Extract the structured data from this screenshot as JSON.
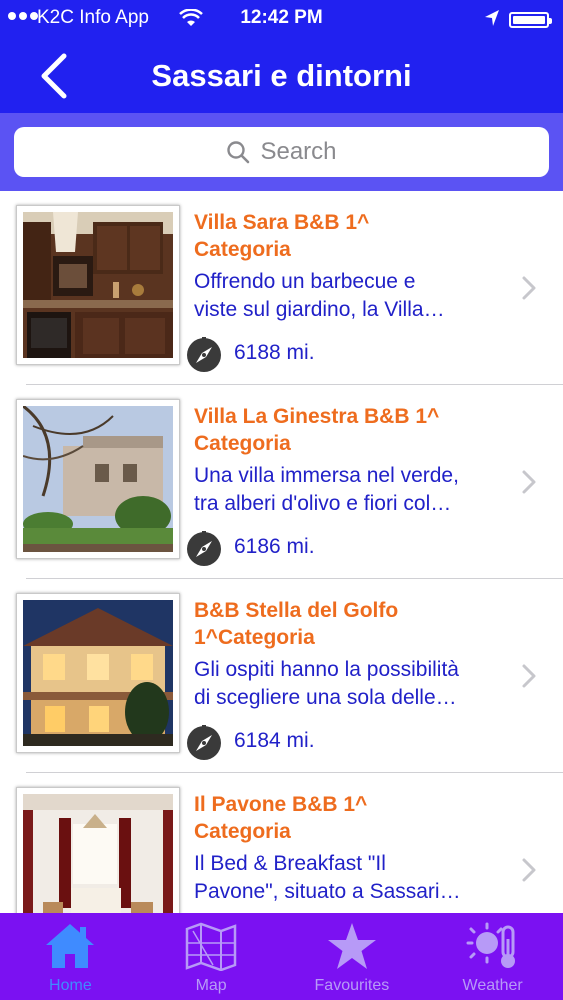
{
  "status_bar": {
    "carrier": "K2C Info App",
    "time": "12:42 PM"
  },
  "nav": {
    "title": "Sassari e dintorni",
    "back_icon": "chevron-left-icon"
  },
  "search": {
    "placeholder": "Search"
  },
  "listings": [
    {
      "title_line1": "Villa Sara B&B 1^",
      "title_line2": "Categoria",
      "desc_line1": "Offrendo un barbecue e",
      "desc_line2": "viste sul giardino, la Villa…",
      "distance": "6188 mi."
    },
    {
      "title_line1": "Villa La Ginestra B&B 1^",
      "title_line2": "Categoria",
      "desc_line1": "Una villa immersa nel verde,",
      "desc_line2": "tra alberi d'olivo e fiori col…",
      "distance": "6186 mi."
    },
    {
      "title_line1": "B&B Stella del Golfo",
      "title_line2": "1^Categoria",
      "desc_line1": "Gli ospiti hanno la possibilità",
      "desc_line2": "di scegliere una sola delle…",
      "distance": "6184 mi."
    },
    {
      "title_line1": "Il Pavone B&B 1^",
      "title_line2": "Categoria",
      "desc_line1": "Il Bed & Breakfast \"Il",
      "desc_line2": "Pavone\", situato a Sassari…",
      "distance": ""
    }
  ],
  "tabs": [
    {
      "label": "Home",
      "icon": "home-icon",
      "active": true
    },
    {
      "label": "Map",
      "icon": "map-icon",
      "active": false
    },
    {
      "label": "Favourites",
      "icon": "star-icon",
      "active": false
    },
    {
      "label": "Weather",
      "icon": "weather-icon",
      "active": false
    }
  ],
  "colors": {
    "nav_bg": "#2121F0",
    "search_bg": "#5B53F3",
    "title_orange": "#EE6C1E",
    "text_blue": "#2121C8",
    "tabbar_bg": "#7B11F2",
    "tab_active": "#3F8BFF"
  }
}
